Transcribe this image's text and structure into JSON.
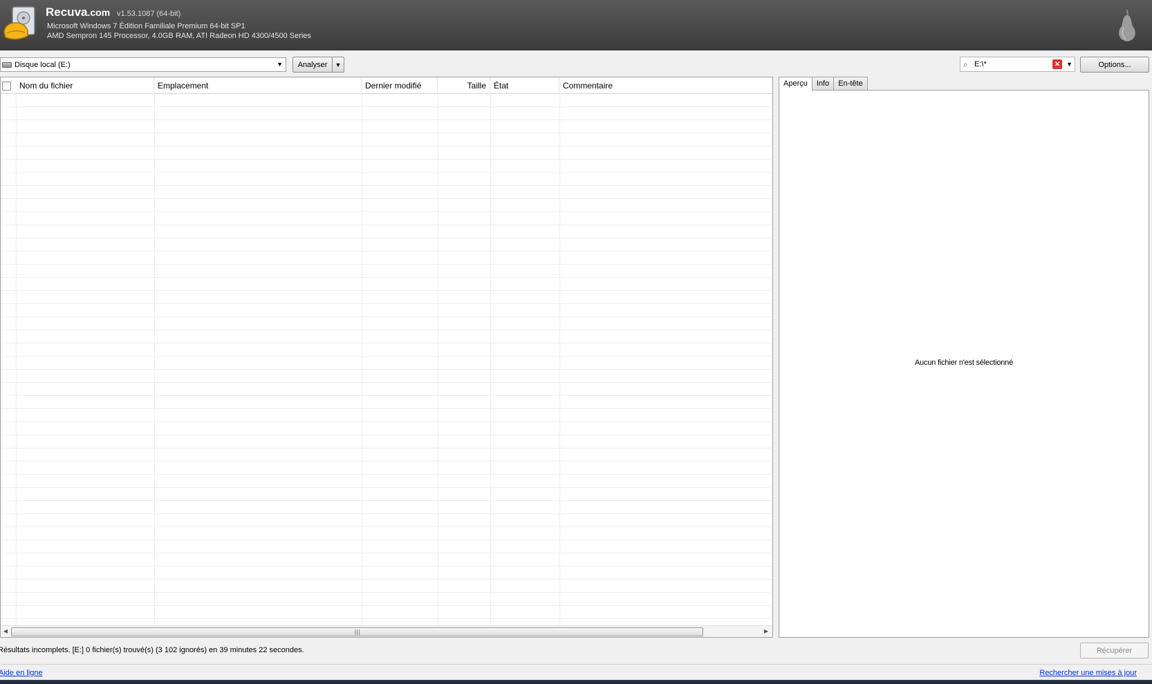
{
  "header": {
    "app_name": "Recuva",
    "app_domain": ".com",
    "version": "v1.53.1087 (64-bit)",
    "system_line1": "Microsoft Windows 7 Édition Familiale Premium 64-bit SP1",
    "system_line2": "AMD Sempron 145 Processor, 4.0GB RAM, ATI Radeon HD 4300/4500 Series"
  },
  "toolbar": {
    "drive": "Disque local (E:)",
    "analyse_label": "Analyser",
    "path_filter": "E:\\*",
    "options_label": "Options..."
  },
  "file_list": {
    "columns": [
      "Nom du fichier",
      "Emplacement",
      "Dernier modifié",
      "Taille",
      "État",
      "Commentaire"
    ]
  },
  "preview": {
    "tabs": [
      "Aperçu",
      "Info",
      "En-tête"
    ],
    "empty_message": "Aucun fichier n'est sélectionné"
  },
  "status": {
    "text": "Résultats incomplets. [E:] 0 fichier(s) trouvé(s) (3 102 ignorés) en 39 minutes 22 secondes.",
    "recover_label": "Récupérer"
  },
  "footer": {
    "help_link": "Aide en ligne",
    "update_link": "Rechercher une mises à jour"
  },
  "icons": {
    "logo": "recuva-logo-icon",
    "pear": "piriform-pear-icon",
    "search": "search-icon",
    "clear": "clear-icon"
  }
}
